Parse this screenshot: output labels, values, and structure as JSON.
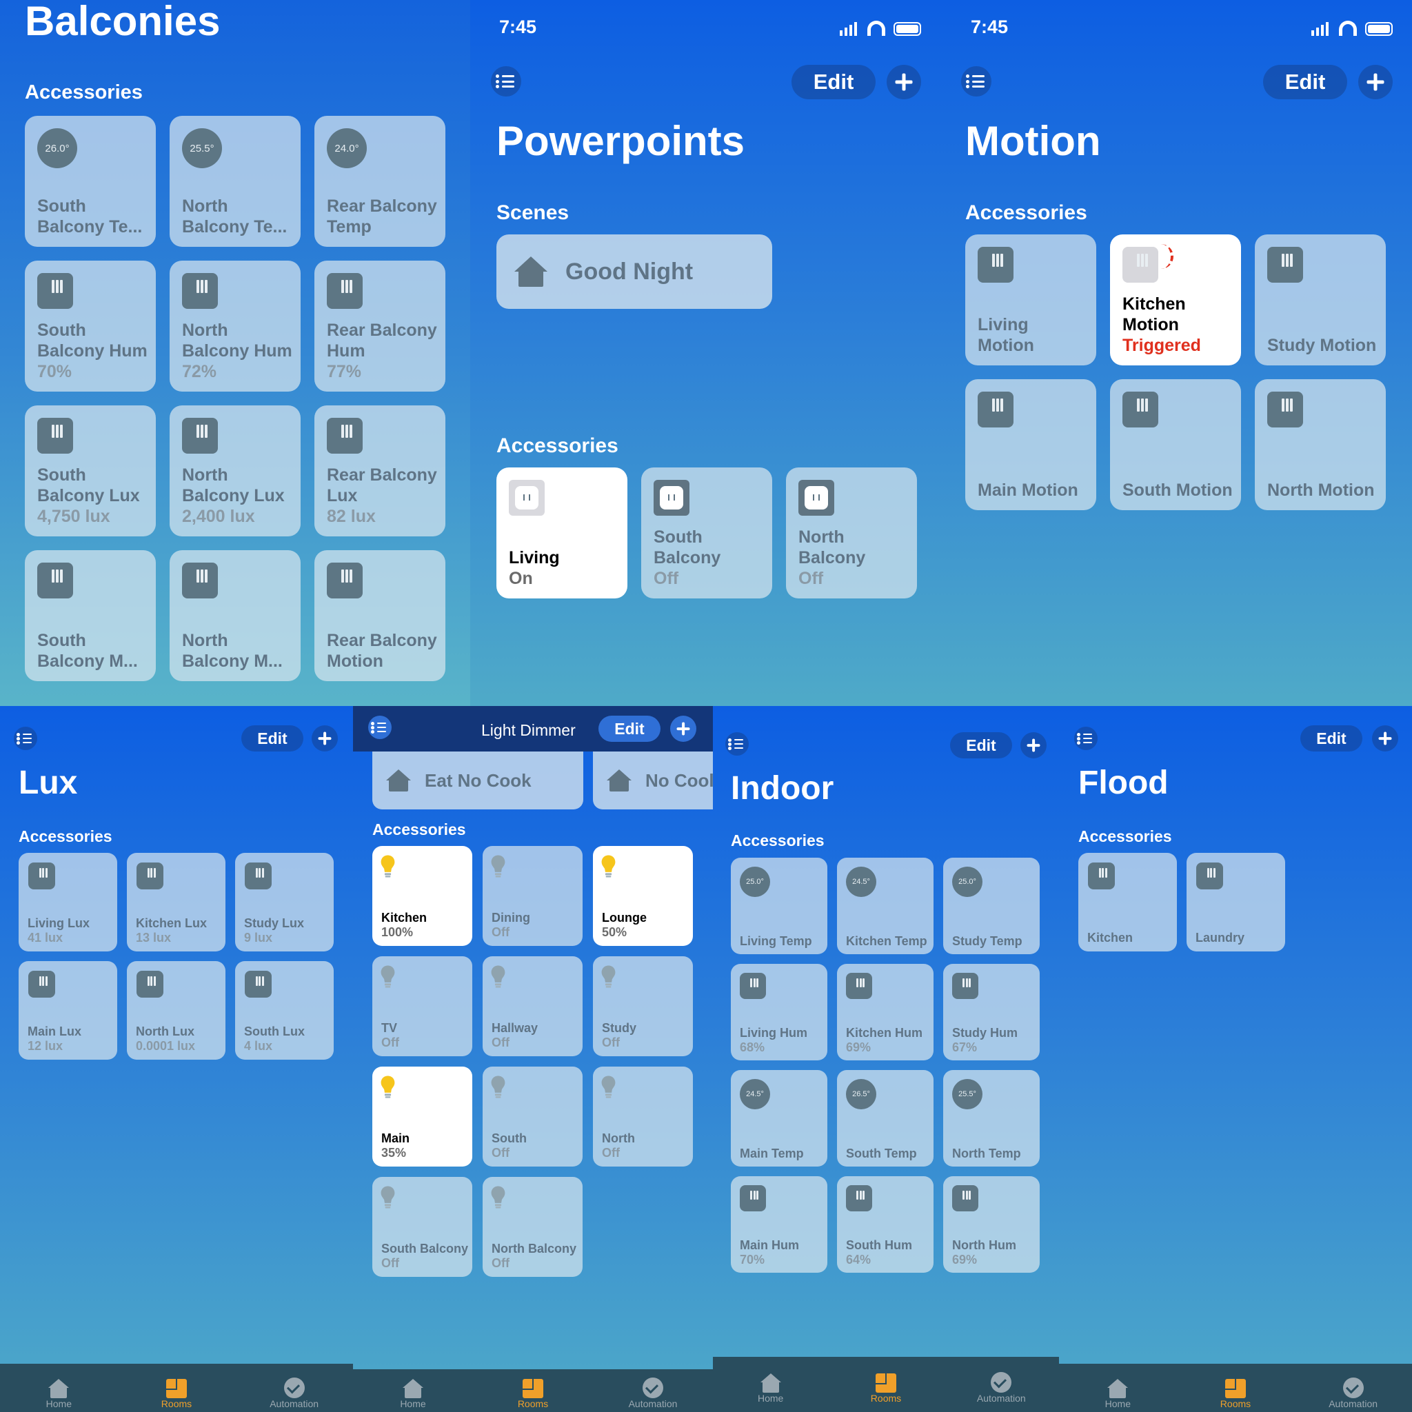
{
  "tabs": {
    "home": "Home",
    "rooms": "Rooms",
    "automation": "Automation"
  },
  "status_time": "7:45",
  "edit": "Edit",
  "accessories_label": "Accessories",
  "balconies": {
    "title": "Balconies",
    "tiles": [
      {
        "kind": "dial",
        "reading": "26.0°",
        "name": "South Balcony Te...",
        "status": ""
      },
      {
        "kind": "dial",
        "reading": "25.5°",
        "name": "North Balcony Te...",
        "status": ""
      },
      {
        "kind": "dial",
        "reading": "24.0°",
        "name": "Rear Balcony Temp",
        "status": ""
      },
      {
        "kind": "sensor",
        "name": "South Balcony Hum",
        "status": "70%"
      },
      {
        "kind": "sensor",
        "name": "North Balcony Hum",
        "status": "72%"
      },
      {
        "kind": "sensor",
        "name": "Rear Balcony Hum",
        "status": "77%"
      },
      {
        "kind": "sensor",
        "name": "South Balcony Lux",
        "status": "4,750 lux"
      },
      {
        "kind": "sensor",
        "name": "North Balcony Lux",
        "status": "2,400 lux"
      },
      {
        "kind": "sensor",
        "name": "Rear Balcony Lux",
        "status": "82 lux"
      },
      {
        "kind": "sensor",
        "name": "South Balcony M...",
        "status": ""
      },
      {
        "kind": "sensor",
        "name": "North Balcony M...",
        "status": ""
      },
      {
        "kind": "sensor",
        "name": "Rear Balcony Motion",
        "status": ""
      }
    ]
  },
  "powerpoints": {
    "title": "Powerpoints",
    "scenes_label": "Scenes",
    "scene": "Good Night",
    "tiles": [
      {
        "kind": "outlet",
        "on": true,
        "name": "Living",
        "status": "On"
      },
      {
        "kind": "outlet",
        "on": false,
        "name": "South Balcony",
        "status": "Off"
      },
      {
        "kind": "outlet",
        "on": false,
        "name": "North Balcony",
        "status": "Off"
      }
    ]
  },
  "motion": {
    "title": "Motion",
    "tiles": [
      {
        "kind": "sensor",
        "name": "Living Motion",
        "status": ""
      },
      {
        "kind": "sensor",
        "on": true,
        "triggered": true,
        "name": "Kitchen Motion",
        "status": "Triggered"
      },
      {
        "kind": "sensor",
        "name": "Study Motion",
        "status": ""
      },
      {
        "kind": "sensor",
        "name": "Main Motion",
        "status": ""
      },
      {
        "kind": "sensor",
        "name": "South Motion",
        "status": ""
      },
      {
        "kind": "sensor",
        "name": "North Motion",
        "status": ""
      }
    ]
  },
  "lux": {
    "title": "Lux",
    "tiles": [
      {
        "kind": "sensor",
        "name": "Living Lux",
        "status": "41 lux"
      },
      {
        "kind": "sensor",
        "name": "Kitchen Lux",
        "status": "13 lux"
      },
      {
        "kind": "sensor",
        "name": "Study Lux",
        "status": "9 lux"
      },
      {
        "kind": "sensor",
        "name": "Main Lux",
        "status": "12 lux"
      },
      {
        "kind": "sensor",
        "name": "North Lux",
        "status": "0.0001 lux"
      },
      {
        "kind": "sensor",
        "name": "South Lux",
        "status": "4 lux"
      }
    ]
  },
  "dimmer": {
    "title": "Light Dimmer",
    "scenes": [
      "Eat No Cook",
      "No Cool"
    ],
    "tiles": [
      {
        "kind": "bulb",
        "on": true,
        "name": "Kitchen",
        "status": "100%"
      },
      {
        "kind": "bulb",
        "name": "Dining",
        "status": "Off"
      },
      {
        "kind": "bulb",
        "on": true,
        "name": "Lounge",
        "status": "50%"
      },
      {
        "kind": "bulb",
        "name": "TV",
        "status": "Off"
      },
      {
        "kind": "bulb",
        "name": "Hallway",
        "status": "Off"
      },
      {
        "kind": "bulb",
        "name": "Study",
        "status": "Off"
      },
      {
        "kind": "bulb",
        "on": true,
        "name": "Main",
        "status": "35%"
      },
      {
        "kind": "bulb",
        "name": "South",
        "status": "Off"
      },
      {
        "kind": "bulb",
        "name": "North",
        "status": "Off"
      },
      {
        "kind": "bulb",
        "name": "South Balcony",
        "status": "Off"
      },
      {
        "kind": "bulb",
        "name": "North Balcony",
        "status": "Off"
      }
    ]
  },
  "indoor": {
    "title": "Indoor",
    "tiles": [
      {
        "kind": "dial",
        "reading": "25.0°",
        "name": "Living Temp",
        "status": ""
      },
      {
        "kind": "dial",
        "reading": "24.5°",
        "name": "Kitchen Temp",
        "status": ""
      },
      {
        "kind": "dial",
        "reading": "25.0°",
        "name": "Study Temp",
        "status": ""
      },
      {
        "kind": "sensor",
        "name": "Living Hum",
        "status": "68%"
      },
      {
        "kind": "sensor",
        "name": "Kitchen Hum",
        "status": "69%"
      },
      {
        "kind": "sensor",
        "name": "Study Hum",
        "status": "67%"
      },
      {
        "kind": "dial",
        "reading": "24.5°",
        "name": "Main Temp",
        "status": ""
      },
      {
        "kind": "dial",
        "reading": "26.5°",
        "name": "South Temp",
        "status": ""
      },
      {
        "kind": "dial",
        "reading": "25.5°",
        "name": "North Temp",
        "status": ""
      },
      {
        "kind": "sensor",
        "name": "Main Hum",
        "status": "70%"
      },
      {
        "kind": "sensor",
        "name": "South Hum",
        "status": "64%"
      },
      {
        "kind": "sensor",
        "name": "North Hum",
        "status": "69%"
      }
    ]
  },
  "flood": {
    "title": "Flood",
    "tiles": [
      {
        "kind": "sensor",
        "name": "Kitchen",
        "status": ""
      },
      {
        "kind": "sensor",
        "name": "Laundry",
        "status": ""
      }
    ]
  }
}
